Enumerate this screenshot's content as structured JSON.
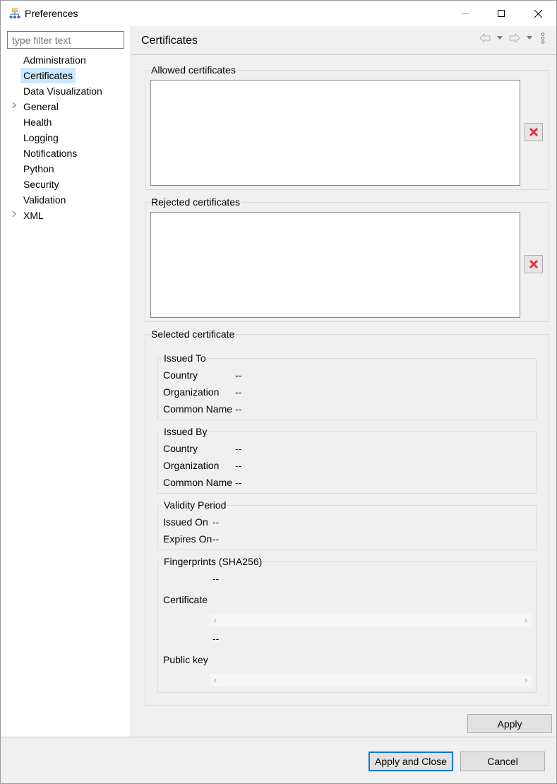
{
  "window": {
    "title": "Preferences"
  },
  "filter": {
    "placeholder": "type filter text"
  },
  "tree": [
    {
      "label": "Administration",
      "expandable": false,
      "selected": false
    },
    {
      "label": "Certificates",
      "expandable": false,
      "selected": true
    },
    {
      "label": "Data Visualization",
      "expandable": false,
      "selected": false
    },
    {
      "label": "General",
      "expandable": true,
      "selected": false
    },
    {
      "label": "Health",
      "expandable": false,
      "selected": false
    },
    {
      "label": "Logging",
      "expandable": false,
      "selected": false
    },
    {
      "label": "Notifications",
      "expandable": false,
      "selected": false
    },
    {
      "label": "Python",
      "expandable": false,
      "selected": false
    },
    {
      "label": "Security",
      "expandable": false,
      "selected": false
    },
    {
      "label": "Validation",
      "expandable": false,
      "selected": false
    },
    {
      "label": "XML",
      "expandable": true,
      "selected": false
    }
  ],
  "page": {
    "title": "Certificates",
    "allowed": {
      "legend": "Allowed certificates"
    },
    "rejected": {
      "legend": "Rejected certificates"
    },
    "selected": {
      "legend": "Selected certificate",
      "issued_to": {
        "legend": "Issued To",
        "country_label": "Country",
        "country_value": "--",
        "org_label": "Organization",
        "org_value": "--",
        "cn_label": "Common Name",
        "cn_value": "--"
      },
      "issued_by": {
        "legend": "Issued By",
        "country_label": "Country",
        "country_value": "--",
        "org_label": "Organization",
        "org_value": "--",
        "cn_label": "Common Name",
        "cn_value": "--"
      },
      "validity": {
        "legend": "Validity Period",
        "issued_on_label": "Issued On",
        "issued_on_value": "--",
        "expires_on_label": "Expires On",
        "expires_on_value": "--"
      },
      "fingerprints": {
        "legend": "Fingerprints (SHA256)",
        "certificate_label": "Certificate",
        "certificate_value": "--",
        "public_key_label": "Public key",
        "public_key_value": "--"
      }
    },
    "apply_label": "Apply"
  },
  "footer": {
    "apply_close_label": "Apply and Close",
    "cancel_label": "Cancel"
  },
  "icons": {
    "app": "preferences-app-icon",
    "minimize": "minimize-icon",
    "maximize": "maximize-icon",
    "close": "close-icon",
    "back": "back-arrow-icon",
    "forward": "forward-arrow-icon",
    "menu": "view-menu-icon",
    "remove": "remove-x-icon",
    "expand": "chevron-right-icon"
  },
  "colors": {
    "selection": "#cce8ff",
    "remove": "#e0303a",
    "default_button_border": "#0078d7"
  }
}
